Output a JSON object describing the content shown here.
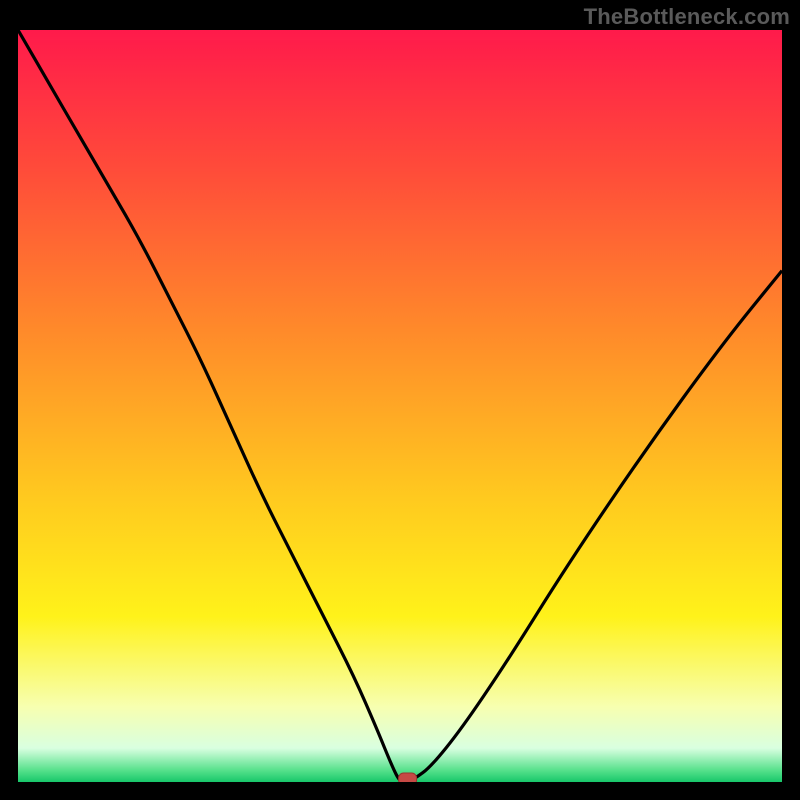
{
  "watermark": "TheBottleneck.com",
  "colors": {
    "frame": "#000000",
    "watermark": "#5a5a5a",
    "curve": "#000000",
    "marker_fill": "#c64a45",
    "marker_stroke": "#9c3630",
    "gradient_stops": [
      {
        "offset": 0.0,
        "color": "#ff1a4b"
      },
      {
        "offset": 0.18,
        "color": "#ff4a3a"
      },
      {
        "offset": 0.4,
        "color": "#ff8a2a"
      },
      {
        "offset": 0.62,
        "color": "#ffc91f"
      },
      {
        "offset": 0.78,
        "color": "#fff21a"
      },
      {
        "offset": 0.9,
        "color": "#f7ffb0"
      },
      {
        "offset": 0.955,
        "color": "#d9ffe0"
      },
      {
        "offset": 0.985,
        "color": "#54e08a"
      },
      {
        "offset": 1.0,
        "color": "#18c76a"
      }
    ]
  },
  "chart_data": {
    "type": "line",
    "title": "",
    "xlabel": "",
    "ylabel": "",
    "xlim": [
      0,
      100
    ],
    "ylim": [
      0,
      100
    ],
    "grid": false,
    "legend": false,
    "series": [
      {
        "name": "bottleneck-curve",
        "x": [
          0,
          4,
          8,
          12,
          16,
          20,
          24,
          28,
          32,
          36,
          40,
          44,
          47,
          49,
          50,
          51,
          52,
          54,
          58,
          64,
          72,
          82,
          92,
          100
        ],
        "values": [
          100,
          93,
          86,
          79,
          72,
          64,
          56,
          47,
          38,
          30,
          22,
          14,
          7,
          2,
          0,
          0,
          0.5,
          2,
          7,
          16,
          29,
          44,
          58,
          68
        ]
      }
    ],
    "marker": {
      "x": 51,
      "y": 0,
      "label": "optimal-point"
    }
  }
}
